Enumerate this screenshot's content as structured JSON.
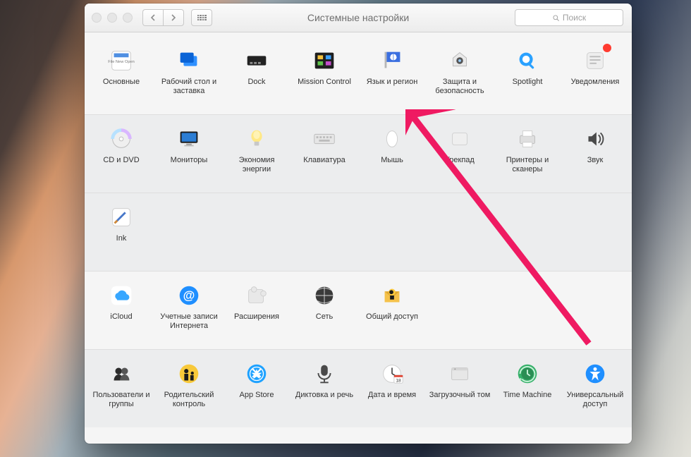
{
  "window": {
    "title": "Системные настройки",
    "search_placeholder": "Поиск"
  },
  "rows": [
    {
      "alt": false,
      "items": [
        {
          "id": "general",
          "label": "Основные"
        },
        {
          "id": "desktop",
          "label": "Рабочий стол и заставка"
        },
        {
          "id": "dock",
          "label": "Dock"
        },
        {
          "id": "mission",
          "label": "Mission Control"
        },
        {
          "id": "language",
          "label": "Язык и регион"
        },
        {
          "id": "security",
          "label": "Защита и безопасность"
        },
        {
          "id": "spotlight",
          "label": "Spotlight"
        },
        {
          "id": "notifications",
          "label": "Уведомления",
          "badge": true
        }
      ]
    },
    {
      "alt": true,
      "items": [
        {
          "id": "cddvd",
          "label": "CD и DVD"
        },
        {
          "id": "displays",
          "label": "Мониторы"
        },
        {
          "id": "energy",
          "label": "Экономия энергии"
        },
        {
          "id": "keyboard",
          "label": "Клавиатура"
        },
        {
          "id": "mouse",
          "label": "Мышь"
        },
        {
          "id": "trackpad",
          "label": "Трекпад"
        },
        {
          "id": "printers",
          "label": "Принтеры и сканеры"
        },
        {
          "id": "sound",
          "label": "Звук"
        }
      ]
    },
    {
      "alt": true,
      "items": [
        {
          "id": "ink",
          "label": "Ink"
        }
      ]
    },
    {
      "alt": false,
      "items": [
        {
          "id": "icloud",
          "label": "iCloud"
        },
        {
          "id": "accounts",
          "label": "Учетные записи Интернета"
        },
        {
          "id": "extensions",
          "label": "Расширения"
        },
        {
          "id": "network",
          "label": "Сеть"
        },
        {
          "id": "sharing",
          "label": "Общий доступ"
        }
      ]
    },
    {
      "alt": true,
      "items": [
        {
          "id": "users",
          "label": "Пользователи и группы"
        },
        {
          "id": "parental",
          "label": "Родительский контроль"
        },
        {
          "id": "appstore",
          "label": "App Store"
        },
        {
          "id": "dictation",
          "label": "Диктовка и речь"
        },
        {
          "id": "datetime",
          "label": "Дата и время"
        },
        {
          "id": "startupdisk",
          "label": "Загрузочный том"
        },
        {
          "id": "timemachine",
          "label": "Time Machine"
        },
        {
          "id": "a11y",
          "label": "Универсальный доступ"
        }
      ]
    }
  ]
}
